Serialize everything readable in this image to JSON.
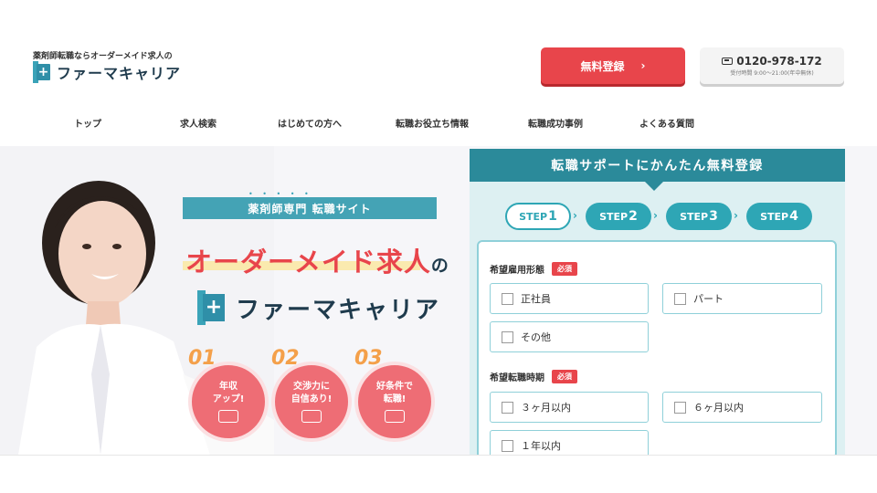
{
  "header": {
    "tagline": "薬剤師転職ならオーダーメイド求人の",
    "logo_text": "ファーマキャリア",
    "register_button": "無料登録",
    "register_chevron": "›",
    "tel_number": "0120-978-172",
    "tel_hours": "受付時間 9:00〜21:00(年中無休)"
  },
  "nav": [
    {
      "label": "トップ"
    },
    {
      "label": "求人検索"
    },
    {
      "label": "はじめての方へ"
    },
    {
      "label": "転職お役立ち情報"
    },
    {
      "label": "転職成功事例"
    },
    {
      "label": "よくある質問"
    }
  ],
  "hero": {
    "dots": "• • • • •",
    "banner": "薬剤師専門 転職サイト",
    "headline": "オーダーメイド求人",
    "headline_suffix": "の",
    "logo_text": "ファーマキャリア",
    "features": [
      {
        "num": "01",
        "line1": "年収",
        "line2": "アップ!"
      },
      {
        "num": "02",
        "line1": "交渉力に",
        "line2": "自信あり!"
      },
      {
        "num": "03",
        "line1": "好条件で",
        "line2": "転職!"
      }
    ]
  },
  "panel": {
    "title": "転職サポートにかんたん無料登録",
    "steps": [
      {
        "label": "STEP",
        "num": "1"
      },
      {
        "label": "STEP",
        "num": "2"
      },
      {
        "label": "STEP",
        "num": "3"
      },
      {
        "label": "STEP",
        "num": "4"
      }
    ],
    "step_arrow": "›",
    "required_badge": "必須",
    "employment": {
      "label": "希望雇用形態",
      "options": [
        "正社員",
        "パート",
        "その他"
      ]
    },
    "timing": {
      "label": "希望転職時期",
      "options": [
        "３ヶ月以内",
        "６ヶ月以内",
        "１年以内"
      ]
    }
  },
  "colors": {
    "accent_red": "#e8454b",
    "teal": "#2b8a9a",
    "teal_light": "#ddf0f2"
  }
}
